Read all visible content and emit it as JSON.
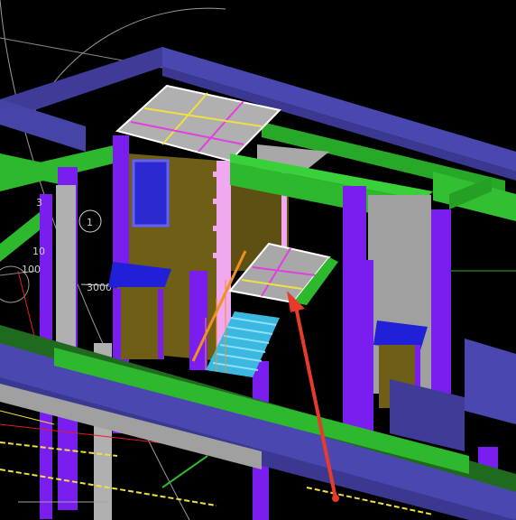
{
  "viewport": {
    "dimension_labels": [
      {
        "id": "dim-1",
        "text": "3"
      },
      {
        "id": "dim-2",
        "text": "1"
      },
      {
        "id": "dim-3",
        "text": "10"
      },
      {
        "id": "dim-4",
        "text": "100"
      },
      {
        "id": "dim-5",
        "text": "3000"
      }
    ]
  },
  "colors": {
    "background": "#000000",
    "slab": "#4a48b0",
    "slab_top": "#5c5ad0",
    "beam": "#2db82d",
    "column": "#7a1ef0",
    "wall": "#7a6a1a",
    "stair": "#3bb8e0",
    "railing": "#f09020",
    "grid_yellow": "#f0e040",
    "grid_magenta": "#e040e0",
    "arrow": "#e83a2a",
    "gray": "#a8a8a8"
  }
}
